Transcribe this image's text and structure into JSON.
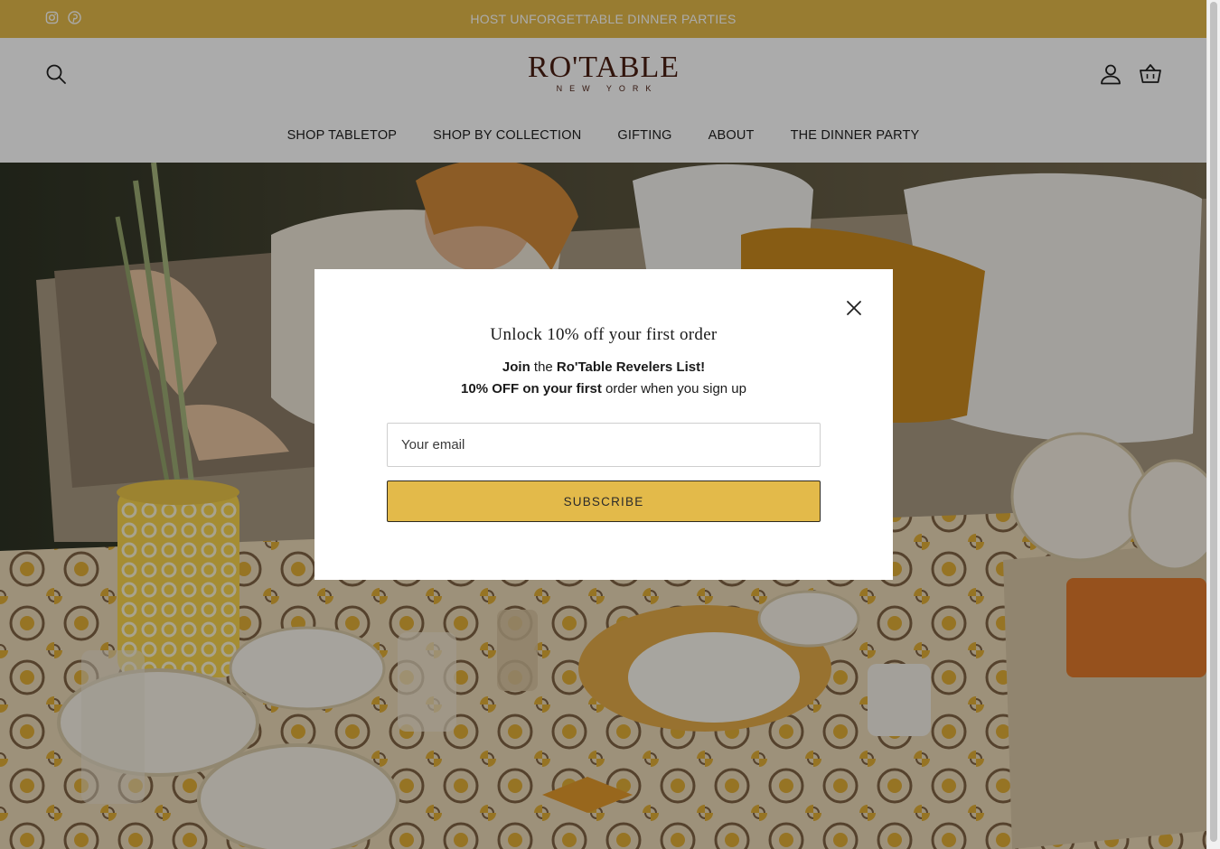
{
  "announcement": {
    "text": "HOST UNFORGETTABLE DINNER PARTIES",
    "social": [
      "instagram-icon",
      "pinterest-icon"
    ]
  },
  "header": {
    "logo_main": "RO'TABLE",
    "logo_sub": "NEW YORK",
    "icons": [
      "search-icon",
      "account-icon",
      "basket-icon"
    ]
  },
  "nav": {
    "items": [
      "SHOP TABLETOP",
      "SHOP BY COLLECTION",
      "GIFTING",
      "ABOUT",
      "THE DINNER PARTY"
    ]
  },
  "popup": {
    "title": "Unlock 10% off your first order",
    "line1_bold_a": "Join",
    "line1_plain": " the ",
    "line1_bold_b": "Ro'Table Revelers List!",
    "line2_bold": "10% OFF on your first",
    "line2_plain": " order when you sign up",
    "email_placeholder": "Your email",
    "subscribe_label": "SUBSCRIBE"
  },
  "colors": {
    "accent": "#e3ba4a",
    "logo": "#4a1e12",
    "overlay": "rgba(0,0,0,0.33)"
  }
}
